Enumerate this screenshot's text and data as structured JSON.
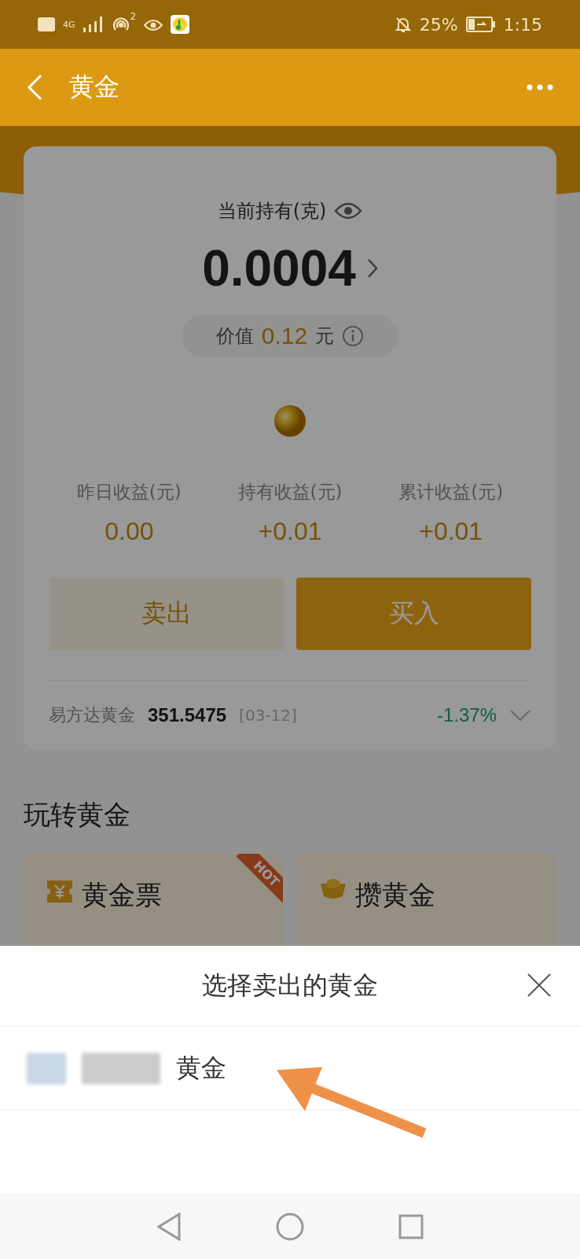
{
  "status_bar": {
    "network": "4G",
    "hotspot_count": "2",
    "battery": "25%",
    "time": "1:15"
  },
  "header": {
    "title": "黄金"
  },
  "holding": {
    "label": "当前持有(克)",
    "amount": "0.0004",
    "value_label": "价值",
    "value": "0.12",
    "value_unit": "元"
  },
  "stats": [
    {
      "label": "昨日收益(元)",
      "value": "0.00"
    },
    {
      "label": "持有收益(元)",
      "value": "+0.01"
    },
    {
      "label": "累计收益(元)",
      "value": "+0.01"
    }
  ],
  "actions": [
    {
      "label": "卖出",
      "kind": "secondary"
    },
    {
      "label": "买入",
      "kind": "primary"
    }
  ],
  "fund": {
    "name": "易方达黄金",
    "price": "351.5475",
    "date": "[03-12]",
    "change": "-1.37%"
  },
  "section": {
    "title": "玩转黄金",
    "cards": [
      {
        "title": "黄金票",
        "kind": "ticket",
        "badge": "HOT"
      },
      {
        "title": "攒黄金",
        "kind": "ingot"
      }
    ]
  },
  "sheet": {
    "title": "选择卖出的黄金",
    "items": [
      {
        "name": "黄金"
      }
    ]
  }
}
